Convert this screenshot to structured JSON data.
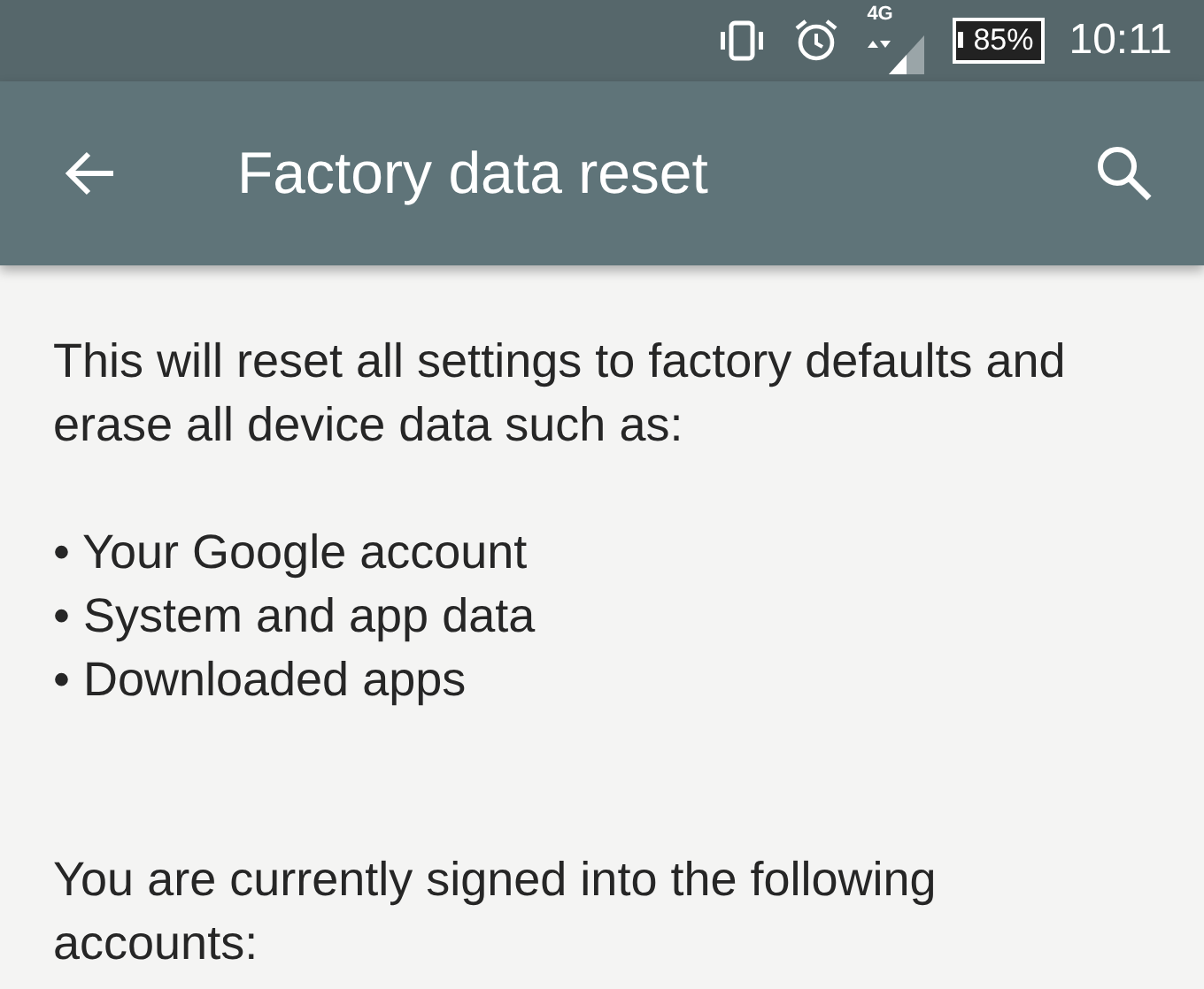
{
  "status_bar": {
    "network": "4G",
    "battery": "85%",
    "time": "10:11"
  },
  "toolbar": {
    "title": "Factory data reset"
  },
  "content": {
    "intro": "This will reset all settings to factory defaults and erase all device data such as:",
    "items": [
      "• Your Google account",
      "• System and app data",
      "• Downloaded apps"
    ],
    "accounts_note": "You are currently signed into the following accounts:"
  }
}
